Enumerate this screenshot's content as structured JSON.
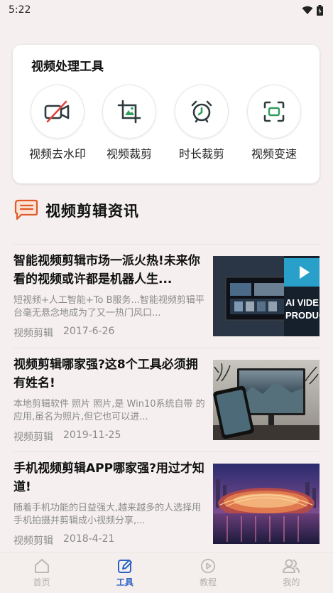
{
  "status_bar": {
    "time": "5:22"
  },
  "tools": {
    "title": "视频处理工具",
    "items": [
      {
        "label": "视频去水印",
        "icon": "video-off-icon"
      },
      {
        "label": "视频裁剪",
        "icon": "crop-image-icon"
      },
      {
        "label": "时长裁剪",
        "icon": "alarm-clock-icon"
      },
      {
        "label": "视频变速",
        "icon": "scan-frame-icon"
      }
    ]
  },
  "section": {
    "title": "视频剪辑资讯",
    "icon": "news-chat-icon"
  },
  "news": [
    {
      "title": "智能视频剪辑市场一派火热!未来你看的视频或许都是机器人生...",
      "desc": "短视频+人工智能+To B服务...智能视频剪辑平台毫无悬念地成为了又一热门风口...",
      "category": "视频剪辑",
      "date": "2017-6-26",
      "thumb_text_1": "AI VIDE",
      "thumb_text_2": "PRODUC"
    },
    {
      "title": "视频剪辑哪家强?这8个工具必须拥有姓名!",
      "desc": "本地剪辑软件 照片 照片,是 Win10系统自带 的应用,虽名为照片,但它也可以进...",
      "category": "视频剪辑",
      "date": "2019-11-25"
    },
    {
      "title": "手机视频剪辑APP哪家强?用过才知道!",
      "desc": "随着手机功能的日益强大,越来越多的人选择用手机拍摄并剪辑成小视频分享,...",
      "category": "视频剪辑",
      "date": "2018-4-21"
    }
  ],
  "bottom_nav": [
    {
      "label": "首页",
      "icon": "home-icon",
      "active": false
    },
    {
      "label": "工具",
      "icon": "edit-icon",
      "active": true
    },
    {
      "label": "教程",
      "icon": "play-circle-icon",
      "active": false
    },
    {
      "label": "我的",
      "icon": "user-group-icon",
      "active": false
    }
  ],
  "colors": {
    "accent": "#2b62c5",
    "icon_dark": "#2f3b3f",
    "icon_green": "#2f9e5c",
    "warning_red": "#e2463c",
    "section_orange": "#e0592a"
  }
}
